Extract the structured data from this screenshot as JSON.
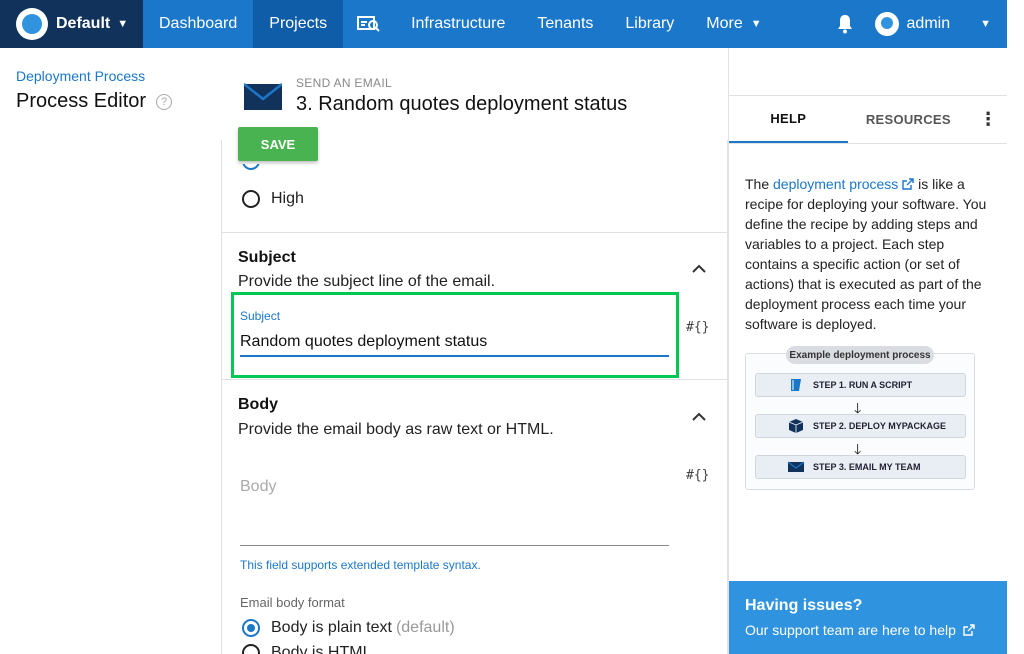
{
  "nav": {
    "space": "Default",
    "items": [
      "Dashboard",
      "Projects",
      "Infrastructure",
      "Tenants",
      "Library",
      "More"
    ],
    "user": "admin"
  },
  "sidebar": {
    "breadcrumb": "Deployment Process",
    "title": "Process Editor"
  },
  "step": {
    "kind": "SEND AN EMAIL",
    "title": "3.  Random quotes deployment status",
    "save_label": "SAVE"
  },
  "priority": {
    "high_label": "High"
  },
  "subject": {
    "title": "Subject",
    "description": "Provide the subject line of the email.",
    "field_label": "Subject",
    "value": "Random quotes deployment status",
    "var_button": "#{}"
  },
  "body": {
    "title": "Body",
    "description": "Provide the email body as raw text or HTML.",
    "placeholder": "Body",
    "var_button": "#{}",
    "hint": "This field supports extended template syntax.",
    "format_label": "Email body format",
    "options": [
      {
        "label": "Body is plain text",
        "suffix": "(default)"
      },
      {
        "label": "Body is HTML"
      }
    ]
  },
  "help_panel": {
    "tabs": [
      "HELP",
      "RESOURCES"
    ],
    "text_prefix": "The ",
    "link": "deployment process",
    "text_suffix": " is like a recipe for deploying your software. You define the recipe by adding steps and variables to a project. Each step contains a specific action (or set of actions) that is executed as part of the deployment process each time your software is deployed.",
    "diagram": {
      "title": "Example deployment process",
      "steps": [
        "STEP 1. RUN A SCRIPT",
        "STEP 2. DEPLOY MYPACKAGE",
        "STEP 3. EMAIL MY TEAM"
      ]
    },
    "issues_title": "Having issues?",
    "issues_link": "Our support team are here to help"
  },
  "colors": {
    "nav_blue": "#1a77ca",
    "brand_dark": "#11325a",
    "save_green": "#48b350",
    "highlight_green": "#00c853"
  }
}
